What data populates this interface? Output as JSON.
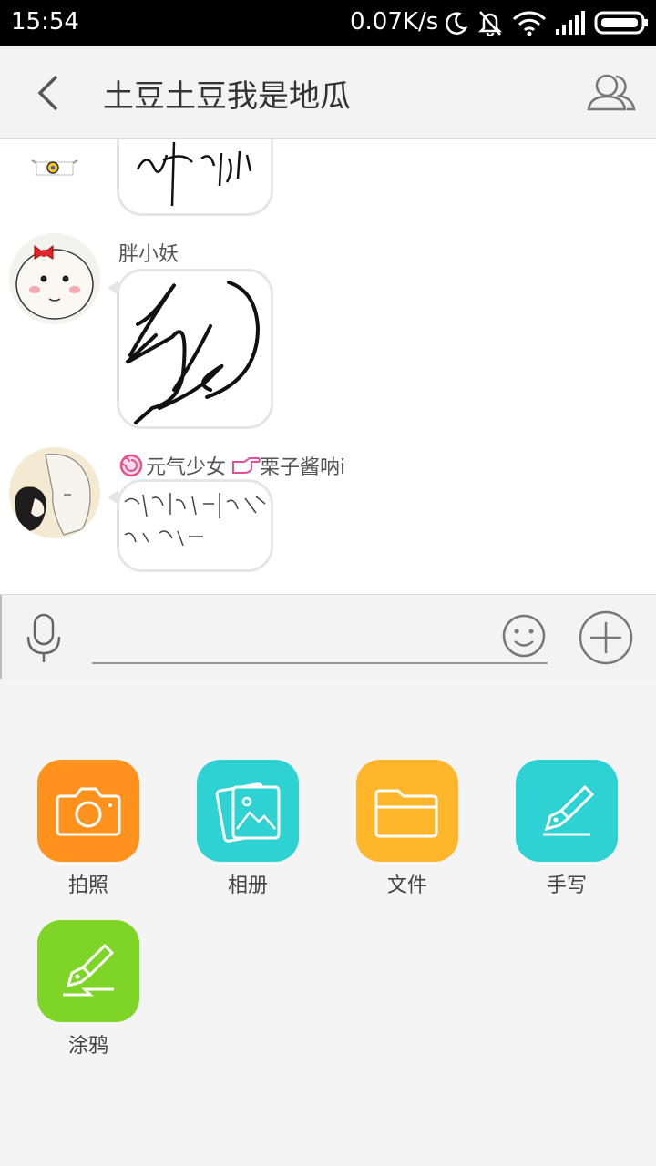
{
  "status_bar": {
    "time": "15:54",
    "net_speed": "0.07K/s"
  },
  "header": {
    "title": "土豆土豆我是地瓜"
  },
  "messages": [
    {
      "sender": "",
      "avatar": "doraemon-avatar"
    },
    {
      "sender": "胖小妖",
      "avatar": "bun-face-avatar"
    },
    {
      "sender_prefix_icon": "lollipop-icon",
      "sender_a": "元气少女",
      "sender_pointer_icon": "pointing-hand-icon",
      "sender_b": "栗子酱呐i",
      "avatar": "anime-couple-avatar"
    }
  ],
  "input": {
    "placeholder": ""
  },
  "tools": [
    {
      "label": "拍照",
      "icon": "camera-icon",
      "color": "#ff921c"
    },
    {
      "label": "相册",
      "icon": "album-icon",
      "color": "#2fd2d2"
    },
    {
      "label": "文件",
      "icon": "folder-icon",
      "color": "#ffb62a"
    },
    {
      "label": "手写",
      "icon": "handwriting-pen-icon",
      "color": "#2fd2d2"
    },
    {
      "label": "涂鸦",
      "icon": "doodle-pen-icon",
      "color": "#7ed528"
    }
  ]
}
